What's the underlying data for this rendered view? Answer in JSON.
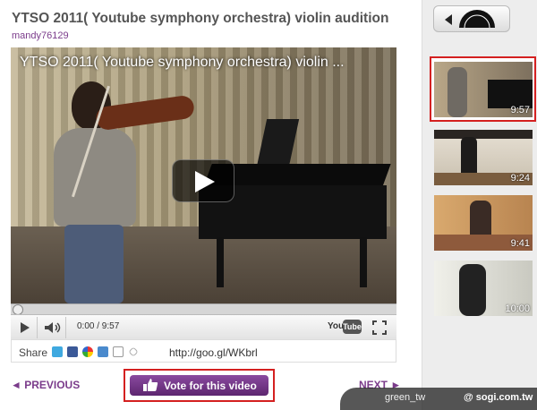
{
  "video": {
    "title": "YTSO 2011( Youtube symphony orchestra) violin audition",
    "author": "mandy76129",
    "overlay_title": "YTSO 2011( Youtube symphony orchestra)  violin ...",
    "time": "0:00 / 9:57",
    "progress": 0
  },
  "controls": {
    "play_icon": "play-icon",
    "volume_icon": "volume-icon",
    "youtube_you": "You",
    "youtube_tube": "Tube",
    "fullscreen_icon": "fullscreen-icon"
  },
  "share": {
    "label": "Share",
    "link": "http://goo.gl/WKbrl"
  },
  "actions": {
    "prev": "◄ PREVIOUS",
    "next": "NEXT ►",
    "vote": "Vote for this video"
  },
  "playlist": [
    {
      "duration": "9:57",
      "selected": true
    },
    {
      "duration": "9:24",
      "selected": false
    },
    {
      "duration": "9:41",
      "selected": false
    },
    {
      "duration": "10:00",
      "selected": false
    }
  ],
  "watermark": {
    "left": "green_tw",
    "right": "@ sogi.com.tw"
  },
  "colors": {
    "accent": "#7b3c8b",
    "highlight_border": "#d42020"
  }
}
